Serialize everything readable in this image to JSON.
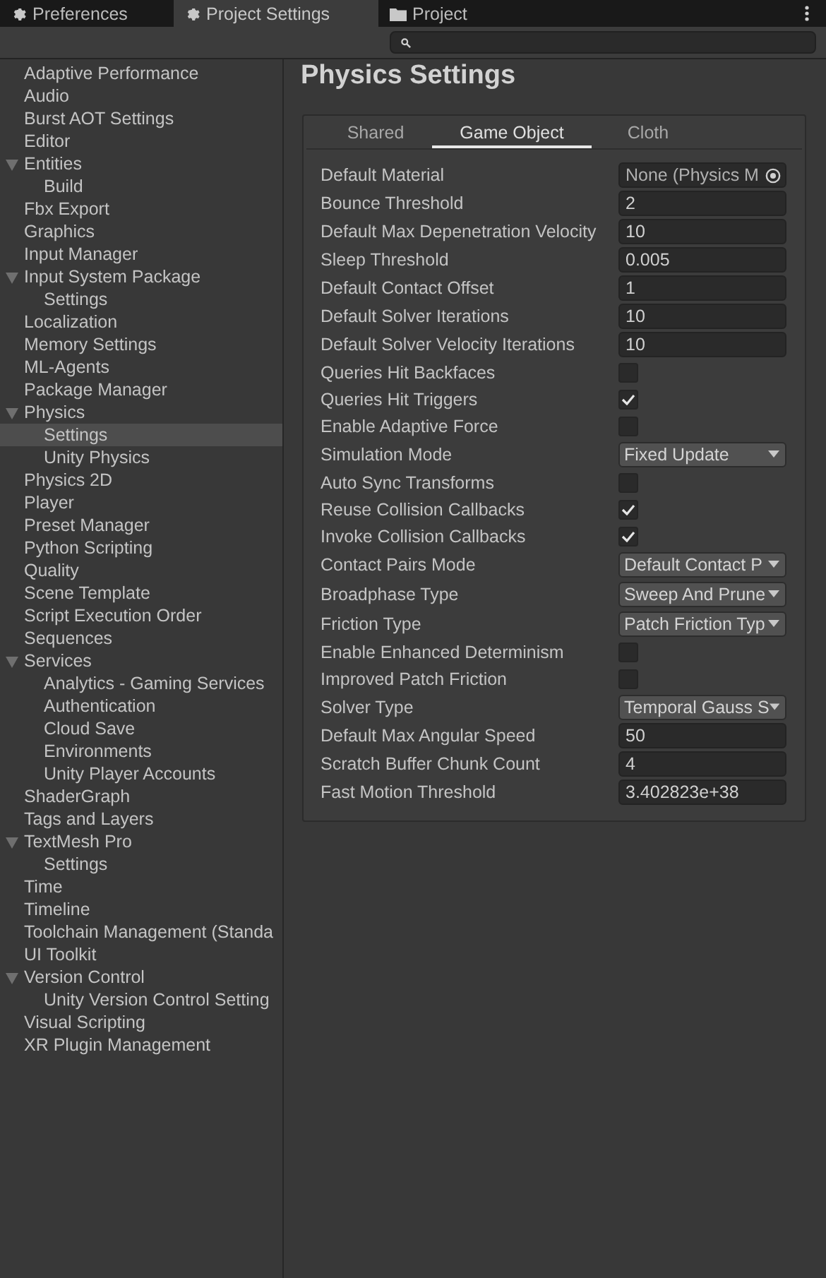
{
  "window_tabs": [
    {
      "label": "Preferences",
      "kind": "settings",
      "selected": false
    },
    {
      "label": "Project Settings",
      "kind": "settings",
      "selected": true
    },
    {
      "label": "Project",
      "kind": "files",
      "selected": false
    }
  ],
  "sidebar": {
    "items": [
      {
        "label": "Adaptive Performance",
        "selected": false
      },
      {
        "label": "Audio",
        "selected": false
      },
      {
        "label": "Burst AOT Settings",
        "selected": false
      },
      {
        "label": "Editor",
        "selected": false
      },
      {
        "label": "Entities",
        "selected": false,
        "expanded": true,
        "children": [
          {
            "label": "Build",
            "selected": false
          }
        ]
      },
      {
        "label": "Fbx Export",
        "selected": false
      },
      {
        "label": "Graphics",
        "selected": false
      },
      {
        "label": "Input Manager",
        "selected": false
      },
      {
        "label": "Input System Package",
        "selected": false,
        "expanded": true,
        "children": [
          {
            "label": "Settings",
            "selected": false
          }
        ]
      },
      {
        "label": "Localization",
        "selected": false
      },
      {
        "label": "Memory Settings",
        "selected": false
      },
      {
        "label": "ML-Agents",
        "selected": false
      },
      {
        "label": "Package Manager",
        "selected": false
      },
      {
        "label": "Physics",
        "selected": false,
        "expanded": true,
        "children": [
          {
            "label": "Settings",
            "selected": true
          },
          {
            "label": "Unity Physics",
            "selected": false
          }
        ]
      },
      {
        "label": "Physics 2D",
        "selected": false
      },
      {
        "label": "Player",
        "selected": false
      },
      {
        "label": "Preset Manager",
        "selected": false
      },
      {
        "label": "Python Scripting",
        "selected": false
      },
      {
        "label": "Quality",
        "selected": false
      },
      {
        "label": "Scene Template",
        "selected": false
      },
      {
        "label": "Script Execution Order",
        "selected": false
      },
      {
        "label": "Sequences",
        "selected": false
      },
      {
        "label": "Services",
        "selected": false,
        "expanded": true,
        "children": [
          {
            "label": "Analytics - Gaming Services",
            "selected": false
          },
          {
            "label": "Authentication",
            "selected": false
          },
          {
            "label": "Cloud Save",
            "selected": false
          },
          {
            "label": "Environments",
            "selected": false
          },
          {
            "label": "Unity Player Accounts",
            "selected": false
          }
        ]
      },
      {
        "label": "ShaderGraph",
        "selected": false
      },
      {
        "label": "Tags and Layers",
        "selected": false
      },
      {
        "label": "TextMesh Pro",
        "selected": false,
        "expanded": true,
        "children": [
          {
            "label": "Settings",
            "selected": false
          }
        ]
      },
      {
        "label": "Time",
        "selected": false
      },
      {
        "label": "Timeline",
        "selected": false
      },
      {
        "label": "Toolchain Management (Standa",
        "selected": false
      },
      {
        "label": "UI Toolkit",
        "selected": false
      },
      {
        "label": "Version Control",
        "selected": false,
        "expanded": true,
        "children": [
          {
            "label": "Unity Version Control Setting",
            "selected": false
          }
        ]
      },
      {
        "label": "Visual Scripting",
        "selected": false
      },
      {
        "label": "XR Plugin Management",
        "selected": false
      }
    ]
  },
  "page": {
    "title": "Physics Settings",
    "tabs": [
      {
        "label": "Shared",
        "selected": false
      },
      {
        "label": "Game Object",
        "selected": true
      },
      {
        "label": "Cloth",
        "selected": false
      }
    ],
    "rows": [
      {
        "kind": "object",
        "label": "Default Material",
        "value": "None (Physics M"
      },
      {
        "kind": "number",
        "label": "Bounce Threshold",
        "value": "2"
      },
      {
        "kind": "number",
        "label": "Default Max Depenetration Velocity",
        "value": "10"
      },
      {
        "kind": "number",
        "label": "Sleep Threshold",
        "value": "0.005"
      },
      {
        "kind": "number",
        "label": "Default Contact Offset",
        "value": "1"
      },
      {
        "kind": "number",
        "label": "Default Solver Iterations",
        "value": "10"
      },
      {
        "kind": "number",
        "label": "Default Solver Velocity Iterations",
        "value": "10"
      },
      {
        "kind": "checkbox",
        "label": "Queries Hit Backfaces",
        "checked": false
      },
      {
        "kind": "checkbox",
        "label": "Queries Hit Triggers",
        "checked": true
      },
      {
        "kind": "checkbox",
        "label": "Enable Adaptive Force",
        "checked": false
      },
      {
        "kind": "dropdown",
        "label": "Simulation Mode",
        "value": "Fixed Update"
      },
      {
        "kind": "checkbox",
        "label": "Auto Sync Transforms",
        "checked": false
      },
      {
        "kind": "checkbox",
        "label": "Reuse Collision Callbacks",
        "checked": true
      },
      {
        "kind": "checkbox",
        "label": "Invoke Collision Callbacks",
        "checked": true
      },
      {
        "kind": "dropdown",
        "label": "Contact Pairs Mode",
        "value": "Default Contact P"
      },
      {
        "kind": "dropdown",
        "label": "Broadphase Type",
        "value": "Sweep And Prune"
      },
      {
        "kind": "dropdown",
        "label": "Friction Type",
        "value": "Patch Friction Typ"
      },
      {
        "kind": "checkbox",
        "label": "Enable Enhanced Determinism",
        "checked": false
      },
      {
        "kind": "checkbox",
        "label": "Improved Patch Friction",
        "checked": false
      },
      {
        "kind": "dropdown",
        "label": "Solver Type",
        "value": "Temporal Gauss S"
      },
      {
        "kind": "number",
        "label": "Default Max Angular Speed",
        "value": "50"
      },
      {
        "kind": "number",
        "label": "Scratch Buffer Chunk Count",
        "value": "4"
      },
      {
        "kind": "number",
        "label": "Fast Motion Threshold",
        "value": "3.402823e+38"
      }
    ]
  }
}
